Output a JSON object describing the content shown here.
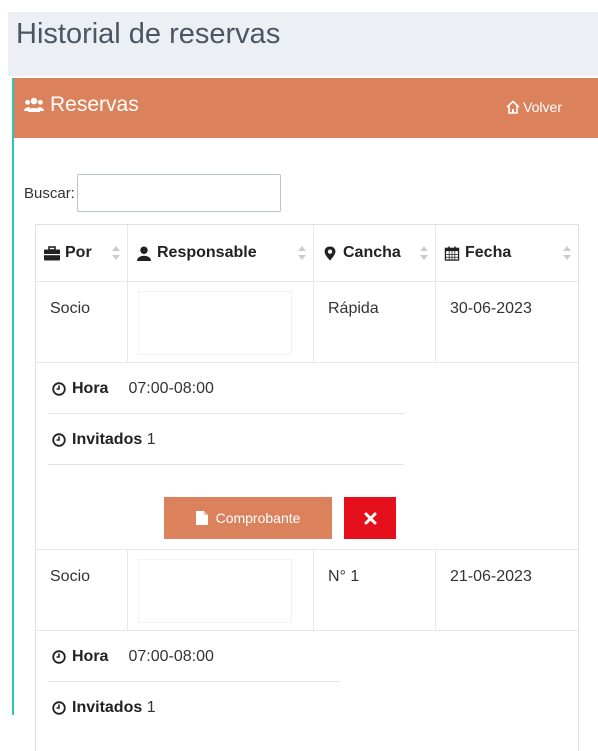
{
  "page": {
    "title": "Historial de reservas"
  },
  "panel": {
    "title": "Reservas",
    "title_icon": "users-icon",
    "back_label": "Volver",
    "back_icon": "home-icon",
    "header_color": "#db825c"
  },
  "search": {
    "label": "Buscar:",
    "value": ""
  },
  "table": {
    "columns": [
      {
        "label": "Por",
        "icon": "briefcase-icon"
      },
      {
        "label": "Responsable",
        "icon": "user-icon"
      },
      {
        "label": "Cancha",
        "icon": "map-marker-icon"
      },
      {
        "label": "Fecha",
        "icon": "calendar-icon"
      }
    ],
    "rows": [
      {
        "por": "Socio",
        "responsable": "",
        "cancha": "Rápida",
        "fecha": "30-06-2023",
        "hora_label": "Hora",
        "hora": "07:00-08:00",
        "invitados_label": "Invitados",
        "invitados": "1",
        "comprobante_label": "Comprobante"
      },
      {
        "por": "Socio",
        "responsable": "",
        "cancha": "N° 1",
        "fecha": "21-06-2023",
        "hora_label": "Hora",
        "hora": "07:00-08:00",
        "invitados_label": "Invitados",
        "invitados": "1"
      }
    ]
  },
  "colors": {
    "accent": "#db825c",
    "danger": "#e5101c",
    "panel_border": "#2ec4b6"
  }
}
